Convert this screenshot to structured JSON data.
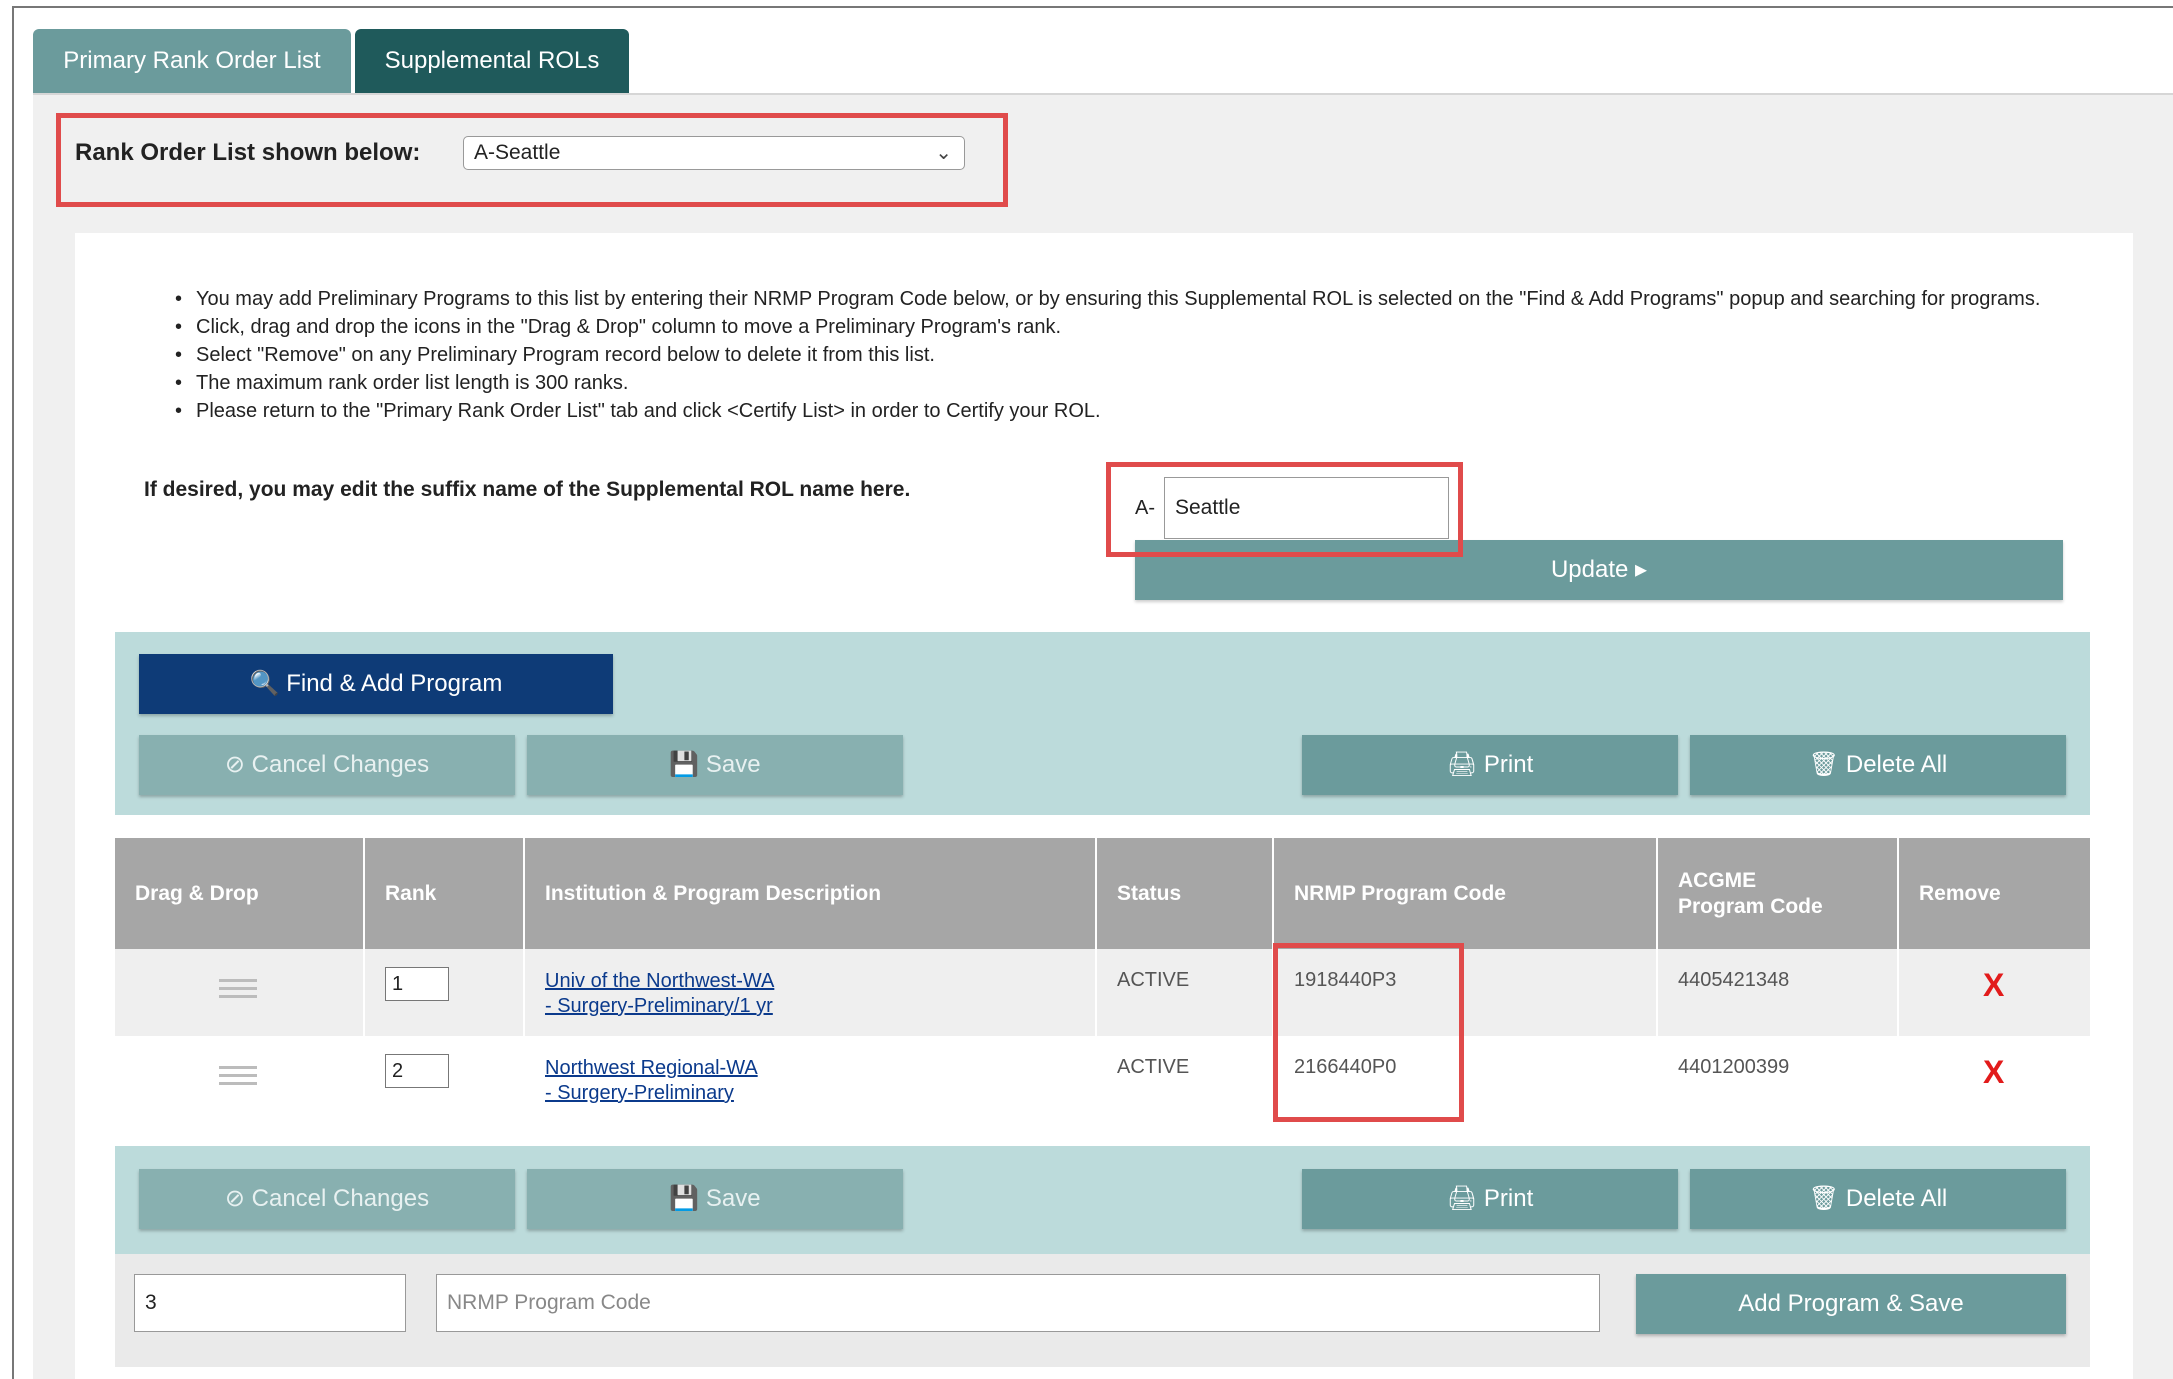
{
  "tabs": [
    {
      "label": "Primary Rank Order List",
      "active": false
    },
    {
      "label": "Supplemental ROLs",
      "active": true
    }
  ],
  "rol_selector": {
    "label": "Rank Order List shown below:",
    "selected": "A-Seattle"
  },
  "instructions": [
    "You may add Preliminary Programs to this list by entering their NRMP Program Code below, or by ensuring this Supplemental ROL is selected on the \"Find & Add Programs\" popup and searching for programs.",
    "Click, drag and drop the icons in the \"Drag & Drop\" column to move a Preliminary Program's rank.",
    "Select \"Remove\" on any Preliminary Program record below to delete it from this list.",
    "The maximum rank order list length is 300 ranks.",
    "Please return to the \"Primary Rank Order List\" tab and click <Certify List> in order to Certify your ROL."
  ],
  "suffix": {
    "label": "If desired, you may edit the suffix name of the Supplemental ROL name here.",
    "prefix": "A-",
    "value": "Seattle"
  },
  "update_label": "Update ▸",
  "toolbar": {
    "find_add": "Find & Add Program",
    "cancel": "Cancel Changes",
    "save": "Save",
    "print": "Print",
    "delete_all": "Delete All"
  },
  "table": {
    "headers": [
      "Drag & Drop",
      "Rank",
      "Institution & Program Description",
      "Status",
      "NRMP Program Code",
      "ACGME Program Code",
      "Remove"
    ],
    "rows": [
      {
        "rank": "1",
        "institution": "Univ of the Northwest-WA",
        "program": "- Surgery-Preliminary/1 yr",
        "status": "ACTIVE",
        "nrmp": "1918440P3",
        "acgme": "4405421348",
        "remove": "X"
      },
      {
        "rank": "2",
        "institution": "Northwest Regional-WA",
        "program": "- Surgery-Preliminary",
        "status": "ACTIVE",
        "nrmp": "2166440P0",
        "acgme": "4401200399",
        "remove": "X"
      }
    ]
  },
  "add_row": {
    "rank_value": "3",
    "code_placeholder": "NRMP Program Code",
    "button": "Add Program & Save"
  },
  "colors": {
    "teal_dark": "#1f5a5b",
    "teal": "#6b9b9c",
    "navy": "#0e3b77",
    "highlight": "#e04b4b",
    "remove": "#e21b1b"
  }
}
